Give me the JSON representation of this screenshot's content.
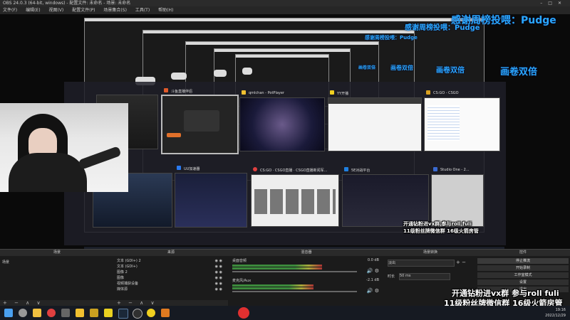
{
  "window": {
    "title": "OBS 24.0.3 (64-bit, windows) - 配置文件: 未命名 - 场景: 未命名",
    "controls": [
      "–",
      "□",
      "✕"
    ]
  },
  "menu": [
    "文件(F)",
    "编辑(E)",
    "视图(V)",
    "配置文件(P)",
    "场景集合(S)",
    "工具(T)",
    "帮助(H)"
  ],
  "overlays": {
    "thanks_big": "感谢周榜投喂：Pudge",
    "thanks_2": "感谢周榜投喂：Pudge",
    "thanks_3": "感谢周榜投喂：Pudge",
    "double_big": "画卷双倍",
    "double_2": "画卷双倍",
    "double_3": "画卷双倍",
    "double_4": "画卷双倍",
    "promo_line1": "开通钻粉进vx群 参与roll fuli",
    "promo_line2": "11级粉丝牌微信群 16级火箭房管"
  },
  "taskview": {
    "windows": [
      {
        "label": "斗鱼直播伴侣",
        "icon_color": "#e05a2a"
      },
      {
        "label": "qmlchan - PotPlayer",
        "icon_color": "#f0c030"
      },
      {
        "label": "YY开播",
        "icon_color": "#f0d020"
      },
      {
        "label": "CS:GO - CSGO",
        "icon_color": "#d8a020"
      },
      {
        "label": "UU加速器",
        "icon_color": "#2a7af0"
      },
      {
        "label": "CS:GO · CSGO直播 · CSGO直播新闻军...",
        "icon_color": "#e04040"
      },
      {
        "label": "5E对战平台",
        "icon_color": "#2080e0"
      },
      {
        "label": "Studio One - 2...",
        "icon_color": "#3a6ad0"
      }
    ]
  },
  "docks": {
    "scenes": {
      "title": "场景",
      "items": [
        "场景"
      ]
    },
    "sources": {
      "title": "来源",
      "items": [
        "文本 (GDI+) 2",
        "文本 (GDI+)",
        "图像 2",
        "图像",
        "视频捕获设备",
        "媒体源"
      ]
    },
    "mixer": {
      "title": "混音器",
      "channels": [
        {
          "name": "桌面音频",
          "level": "0.0 dB",
          "fill": 0.72
        },
        {
          "name": "麦克风/Aux",
          "level": "-2.1 dB",
          "fill": 0.65
        }
      ]
    },
    "transitions": {
      "title": "场景转换",
      "type": "淡出",
      "duration_label": "时长",
      "duration_value": "50 ms"
    },
    "controls": {
      "title": "控件",
      "buttons": [
        "停止推流",
        "开始录制",
        "工作室模式",
        "设置",
        "退出"
      ]
    },
    "footer_icons": "+ − ∧ ∨"
  },
  "taskbar": {
    "time": "19:16",
    "date": "2022/12/29",
    "icons": [
      "start-icon",
      "search-icon",
      "folder-icon",
      "chrome-icon",
      "mic-icon",
      "potplayer-icon",
      "steam-icon",
      "obs-icon",
      "yy-icon",
      "csgo-icon",
      "app-icon"
    ]
  }
}
